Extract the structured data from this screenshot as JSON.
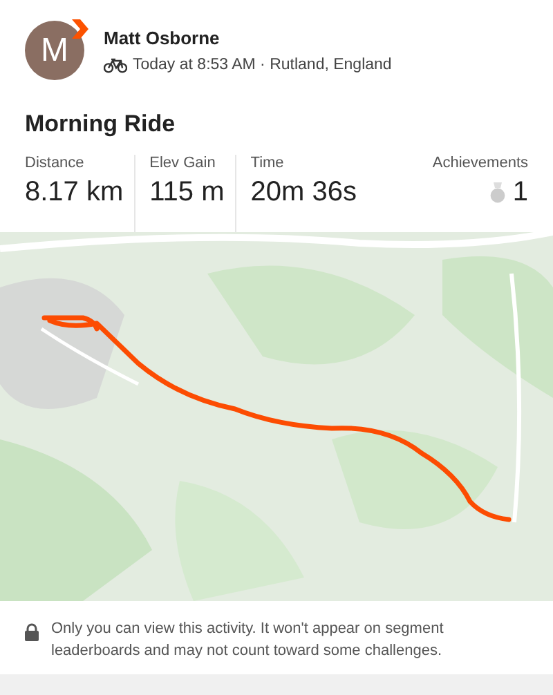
{
  "athlete": {
    "initial": "M",
    "name": "Matt Osborne",
    "meta": "Today at 8:53 AM · Rutland, England"
  },
  "activity": {
    "title": "Morning Ride"
  },
  "stats": [
    {
      "label": "Distance",
      "value": "8.17 km",
      "kind": "plain"
    },
    {
      "label": "Elev Gain",
      "value": "115 m",
      "kind": "plain"
    },
    {
      "label": "Time",
      "value": "20m 36s",
      "kind": "plain"
    },
    {
      "label": "Achievements",
      "value": "1",
      "kind": "medal"
    }
  ],
  "privacy_note": "Only you can view this activity. It won't appear on segment leaderboards and may not count toward some challenges."
}
